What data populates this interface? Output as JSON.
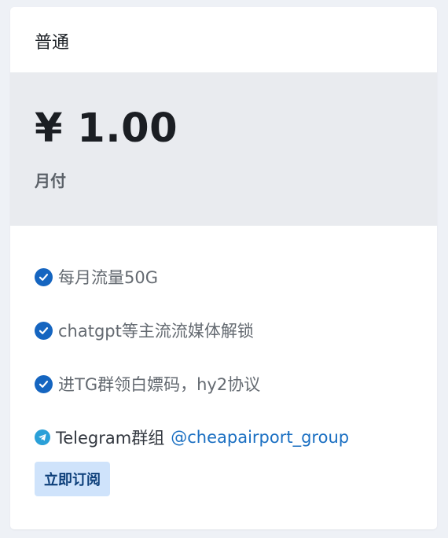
{
  "plan": {
    "name": "普通",
    "price": "¥ 1.00",
    "period": "月付"
  },
  "features": [
    {
      "icon": "check-circle-icon",
      "text": "每月流量50G"
    },
    {
      "icon": "check-circle-icon",
      "text": "chatgpt等主流流媒体解锁"
    },
    {
      "icon": "check-circle-icon",
      "text": "进TG群领白嫖码，hy2协议"
    }
  ],
  "telegram": {
    "icon": "telegram-icon",
    "label": "Telegram群组",
    "link_text": "@cheapairport_group"
  },
  "subscribe_label": "立即订阅",
  "colors": {
    "accent": "#1565c0",
    "button_bg": "#cfe3fb",
    "link": "#1a6fc2",
    "telegram": "#2aa0d8"
  }
}
